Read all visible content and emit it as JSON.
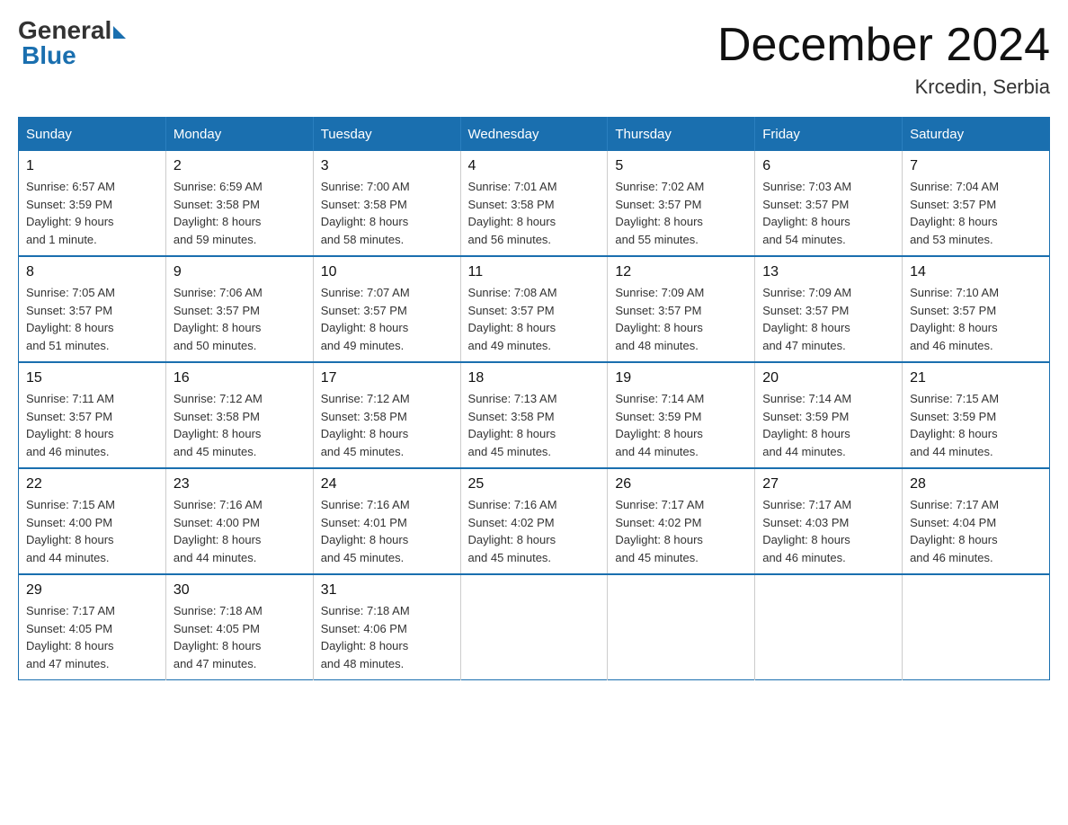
{
  "logo": {
    "general": "General",
    "blue": "Blue"
  },
  "title": "December 2024",
  "location": "Krcedin, Serbia",
  "days_of_week": [
    "Sunday",
    "Monday",
    "Tuesday",
    "Wednesday",
    "Thursday",
    "Friday",
    "Saturday"
  ],
  "weeks": [
    [
      {
        "day": "1",
        "sunrise": "6:57 AM",
        "sunset": "3:59 PM",
        "daylight": "9 hours and 1 minute."
      },
      {
        "day": "2",
        "sunrise": "6:59 AM",
        "sunset": "3:58 PM",
        "daylight": "8 hours and 59 minutes."
      },
      {
        "day": "3",
        "sunrise": "7:00 AM",
        "sunset": "3:58 PM",
        "daylight": "8 hours and 58 minutes."
      },
      {
        "day": "4",
        "sunrise": "7:01 AM",
        "sunset": "3:58 PM",
        "daylight": "8 hours and 56 minutes."
      },
      {
        "day": "5",
        "sunrise": "7:02 AM",
        "sunset": "3:57 PM",
        "daylight": "8 hours and 55 minutes."
      },
      {
        "day": "6",
        "sunrise": "7:03 AM",
        "sunset": "3:57 PM",
        "daylight": "8 hours and 54 minutes."
      },
      {
        "day": "7",
        "sunrise": "7:04 AM",
        "sunset": "3:57 PM",
        "daylight": "8 hours and 53 minutes."
      }
    ],
    [
      {
        "day": "8",
        "sunrise": "7:05 AM",
        "sunset": "3:57 PM",
        "daylight": "8 hours and 51 minutes."
      },
      {
        "day": "9",
        "sunrise": "7:06 AM",
        "sunset": "3:57 PM",
        "daylight": "8 hours and 50 minutes."
      },
      {
        "day": "10",
        "sunrise": "7:07 AM",
        "sunset": "3:57 PM",
        "daylight": "8 hours and 49 minutes."
      },
      {
        "day": "11",
        "sunrise": "7:08 AM",
        "sunset": "3:57 PM",
        "daylight": "8 hours and 49 minutes."
      },
      {
        "day": "12",
        "sunrise": "7:09 AM",
        "sunset": "3:57 PM",
        "daylight": "8 hours and 48 minutes."
      },
      {
        "day": "13",
        "sunrise": "7:09 AM",
        "sunset": "3:57 PM",
        "daylight": "8 hours and 47 minutes."
      },
      {
        "day": "14",
        "sunrise": "7:10 AM",
        "sunset": "3:57 PM",
        "daylight": "8 hours and 46 minutes."
      }
    ],
    [
      {
        "day": "15",
        "sunrise": "7:11 AM",
        "sunset": "3:57 PM",
        "daylight": "8 hours and 46 minutes."
      },
      {
        "day": "16",
        "sunrise": "7:12 AM",
        "sunset": "3:58 PM",
        "daylight": "8 hours and 45 minutes."
      },
      {
        "day": "17",
        "sunrise": "7:12 AM",
        "sunset": "3:58 PM",
        "daylight": "8 hours and 45 minutes."
      },
      {
        "day": "18",
        "sunrise": "7:13 AM",
        "sunset": "3:58 PM",
        "daylight": "8 hours and 45 minutes."
      },
      {
        "day": "19",
        "sunrise": "7:14 AM",
        "sunset": "3:59 PM",
        "daylight": "8 hours and 44 minutes."
      },
      {
        "day": "20",
        "sunrise": "7:14 AM",
        "sunset": "3:59 PM",
        "daylight": "8 hours and 44 minutes."
      },
      {
        "day": "21",
        "sunrise": "7:15 AM",
        "sunset": "3:59 PM",
        "daylight": "8 hours and 44 minutes."
      }
    ],
    [
      {
        "day": "22",
        "sunrise": "7:15 AM",
        "sunset": "4:00 PM",
        "daylight": "8 hours and 44 minutes."
      },
      {
        "day": "23",
        "sunrise": "7:16 AM",
        "sunset": "4:00 PM",
        "daylight": "8 hours and 44 minutes."
      },
      {
        "day": "24",
        "sunrise": "7:16 AM",
        "sunset": "4:01 PM",
        "daylight": "8 hours and 45 minutes."
      },
      {
        "day": "25",
        "sunrise": "7:16 AM",
        "sunset": "4:02 PM",
        "daylight": "8 hours and 45 minutes."
      },
      {
        "day": "26",
        "sunrise": "7:17 AM",
        "sunset": "4:02 PM",
        "daylight": "8 hours and 45 minutes."
      },
      {
        "day": "27",
        "sunrise": "7:17 AM",
        "sunset": "4:03 PM",
        "daylight": "8 hours and 46 minutes."
      },
      {
        "day": "28",
        "sunrise": "7:17 AM",
        "sunset": "4:04 PM",
        "daylight": "8 hours and 46 minutes."
      }
    ],
    [
      {
        "day": "29",
        "sunrise": "7:17 AM",
        "sunset": "4:05 PM",
        "daylight": "8 hours and 47 minutes."
      },
      {
        "day": "30",
        "sunrise": "7:18 AM",
        "sunset": "4:05 PM",
        "daylight": "8 hours and 47 minutes."
      },
      {
        "day": "31",
        "sunrise": "7:18 AM",
        "sunset": "4:06 PM",
        "daylight": "8 hours and 48 minutes."
      },
      null,
      null,
      null,
      null
    ]
  ],
  "labels": {
    "sunrise": "Sunrise:",
    "sunset": "Sunset:",
    "daylight": "Daylight:"
  }
}
